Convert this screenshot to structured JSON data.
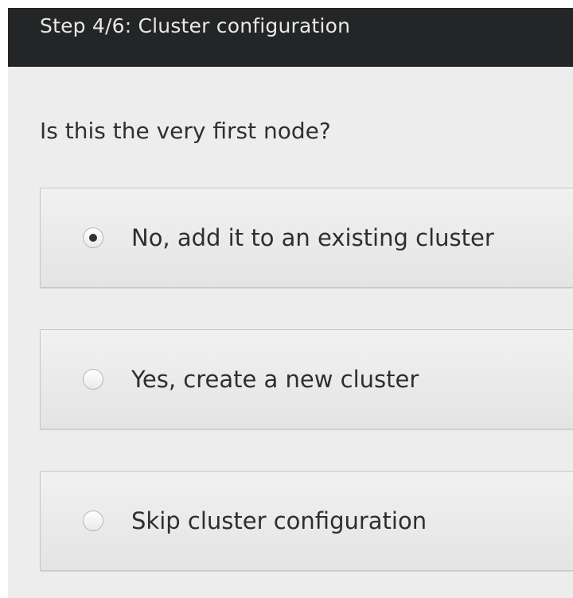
{
  "header": {
    "title": "Step 4/6: Cluster configuration"
  },
  "question": "Is this the very first node?",
  "options": [
    {
      "label": "No, add it to an existing cluster",
      "selected": true
    },
    {
      "label": "Yes, create a new cluster",
      "selected": false
    },
    {
      "label": "Skip cluster configuration",
      "selected": false
    }
  ],
  "colors": {
    "header_bg": "#232526",
    "page_bg": "#ededed",
    "option_bg": "#e8e8e8"
  }
}
